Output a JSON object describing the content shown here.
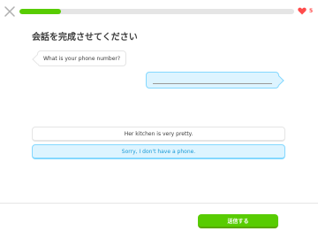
{
  "header": {
    "progress_fraction": 0.15,
    "hearts_count": "5"
  },
  "prompt": {
    "title": "会話を完成させてください"
  },
  "conversation": {
    "question": "What is your phone number?"
  },
  "choices": [
    {
      "label": "Her kitchen is very pretty.",
      "selected": false
    },
    {
      "label": "Sorry, I don't have a phone.",
      "selected": true
    }
  ],
  "footer": {
    "submit_label": "送信する"
  },
  "colors": {
    "accent_green": "#58cc02",
    "selected_blue_bg": "#ddf4ff",
    "selected_blue_border": "#84d8ff",
    "selected_blue_text": "#1899d6",
    "heart_red": "#ff4b4b"
  }
}
